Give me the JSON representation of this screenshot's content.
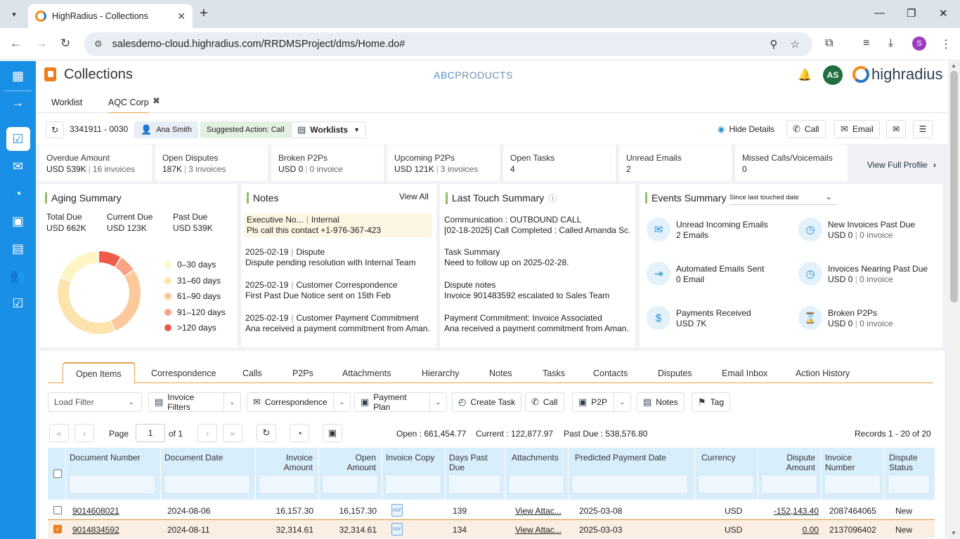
{
  "browser": {
    "tab_title": "HighRadius - Collections",
    "url": "salesdemo-cloud.highradius.com/RRDMSProject/dms/Home.do#",
    "profile_initial": "S"
  },
  "app": {
    "title": "Collections",
    "center_logo_a": "ABC",
    "center_logo_b": "PRODUCTS",
    "avatar": "AS",
    "brand": "highradius",
    "accent": "#1a8fe6"
  },
  "worktabs": [
    "Worklist",
    "AQC Corp"
  ],
  "context": {
    "account": "3341911 - 0030",
    "user": "Ana Smith",
    "suggested": "Suggested Action: Call",
    "worklists": "Worklists",
    "hide_details": "Hide Details",
    "call": "Call",
    "email": "Email"
  },
  "metrics": [
    {
      "label": "Overdue Amount",
      "value": "USD 539K",
      "sub": "16 invoices"
    },
    {
      "label": "Open Disputes",
      "value": "187K",
      "sub": "3 invoices"
    },
    {
      "label": "Broken P2Ps",
      "value": "USD 0",
      "sub": "0 invoice"
    },
    {
      "label": "Upcoming P2Ps",
      "value": "USD 121K",
      "sub": "3 invoices"
    },
    {
      "label": "Open Tasks",
      "value": "4",
      "sub": ""
    },
    {
      "label": "Unread Emails",
      "value": "2",
      "sub": ""
    },
    {
      "label": "Missed Calls/Voicemails",
      "value": "0",
      "sub": ""
    }
  ],
  "view_full_profile": "View Full Profile",
  "aging": {
    "title": "Aging Summary",
    "total_label": "Total Due",
    "total": "USD 662K",
    "current_label": "Current Due",
    "current": "USD 123K",
    "past_label": "Past Due",
    "past": "USD 539K",
    "buckets": [
      {
        "label": "0–30 days",
        "color": "#fdf5c4",
        "share": 0.19
      },
      {
        "label": "31–60 days",
        "color": "#fde3ac",
        "share": 0.37
      },
      {
        "label": "61–90 days",
        "color": "#fdc99a",
        "share": 0.28
      },
      {
        "label": "91–120 days",
        "color": "#f9a585",
        "share": 0.07
      },
      {
        "label": ">120 days",
        "color": "#ef5a4a",
        "share": 0.09
      }
    ]
  },
  "notes": {
    "title": "Notes",
    "view_all": "View All",
    "items": [
      {
        "head": "Executive No...",
        "tag": "Internal",
        "body": "Pls call this contact +1-976-367-423"
      },
      {
        "head": "2025-02-19",
        "tag": "Dispute",
        "body": "Dispute pending resolution with Internal Team"
      },
      {
        "head": "2025-02-19",
        "tag": "Customer Correspondence",
        "body": "First Past Due Notice sent on 15th Feb"
      },
      {
        "head": "2025-02-19",
        "tag": "Customer Payment Commitment",
        "body": "Ana received a payment commitment from Aman..."
      }
    ]
  },
  "lasttouch": {
    "title": "Last Touch Summary",
    "items": [
      {
        "head": "Communication : OUTBOUND CALL",
        "body": "[02-18-2025] Call Completed : Called Amanda Sc..."
      },
      {
        "head": "Task Summary",
        "body": "Need to follow up on 2025-02-28."
      },
      {
        "head": "Dispute notes",
        "body": "Invoice 901483592 escalated to Sales Team"
      },
      {
        "head": "Payment Commitment: Invoice Associated",
        "body": "Ana received a payment commitment from Aman..."
      }
    ]
  },
  "events": {
    "title": "Events Summary",
    "filter": "Since last touched date",
    "items": [
      {
        "label": "Unread Incoming Emails",
        "value": "2 Emails",
        "sub": "",
        "icon": "mail-icon"
      },
      {
        "label": "New Invoices Past Due",
        "value": "USD 0",
        "sub": "0 invoice",
        "icon": "clock-icon"
      },
      {
        "label": "Automated Emails Sent",
        "value": "0 Email",
        "sub": "",
        "icon": "send-icon"
      },
      {
        "label": "Invoices Nearing Past Due",
        "value": "USD 0",
        "sub": "0 invoice",
        "icon": "clock-icon"
      },
      {
        "label": "Payments Received",
        "value": "USD 7K",
        "sub": "",
        "icon": "dollar-icon"
      },
      {
        "label": "Broken P2Ps",
        "value": "USD 0",
        "sub": "0 invoice",
        "icon": "hourglass-icon"
      }
    ]
  },
  "itabs": [
    "Open Items",
    "Correspondence",
    "Calls",
    "P2Ps",
    "Attachments",
    "Hierarchy",
    "Notes",
    "Tasks",
    "Contacts",
    "Disputes",
    "Email Inbox",
    "Action History"
  ],
  "actions": {
    "load_filter": "Load Filter",
    "invoice_filters": "Invoice Filters",
    "correspondence": "Correspondence",
    "payment_plan": "Payment Plan",
    "create_task": "Create Task",
    "call": "Call",
    "p2p": "P2P",
    "notes": "Notes",
    "tag": "Tag"
  },
  "pager": {
    "page_label": "Page",
    "page": "1",
    "of": "of 1",
    "open": "Open : 661,454.77",
    "current": "Current : 122,877.97",
    "pastdue": "Past Due : 538,576.80",
    "records": "Records 1 - 20 of 20"
  },
  "grid": {
    "columns": [
      "Document Number",
      "Document Date",
      "Invoice Amount",
      "Open Amount",
      "Invoice Copy",
      "Days Past Due",
      "Attachments",
      "Predicted Payment Date",
      "Currency",
      "Dispute Amount",
      "Invoice Number",
      "Dispute Status"
    ],
    "rows": [
      {
        "doc": "9014608021",
        "date": "2024-08-06",
        "inv": "16,157.30",
        "open": "16,157.30",
        "days": "139",
        "att": "View Attac...",
        "pred": "2025-03-08",
        "cur": "USD",
        "disp": "-152,143.40",
        "invno": "2087464065",
        "status": "New",
        "selected": false
      },
      {
        "doc": "9014834592",
        "date": "2024-08-11",
        "inv": "32,314.61",
        "open": "32,314.61",
        "days": "134",
        "att": "View Attac...",
        "pred": "2025-03-03",
        "cur": "USD",
        "disp": "0.00",
        "invno": "2137096402",
        "status": "New",
        "selected": true
      }
    ]
  }
}
